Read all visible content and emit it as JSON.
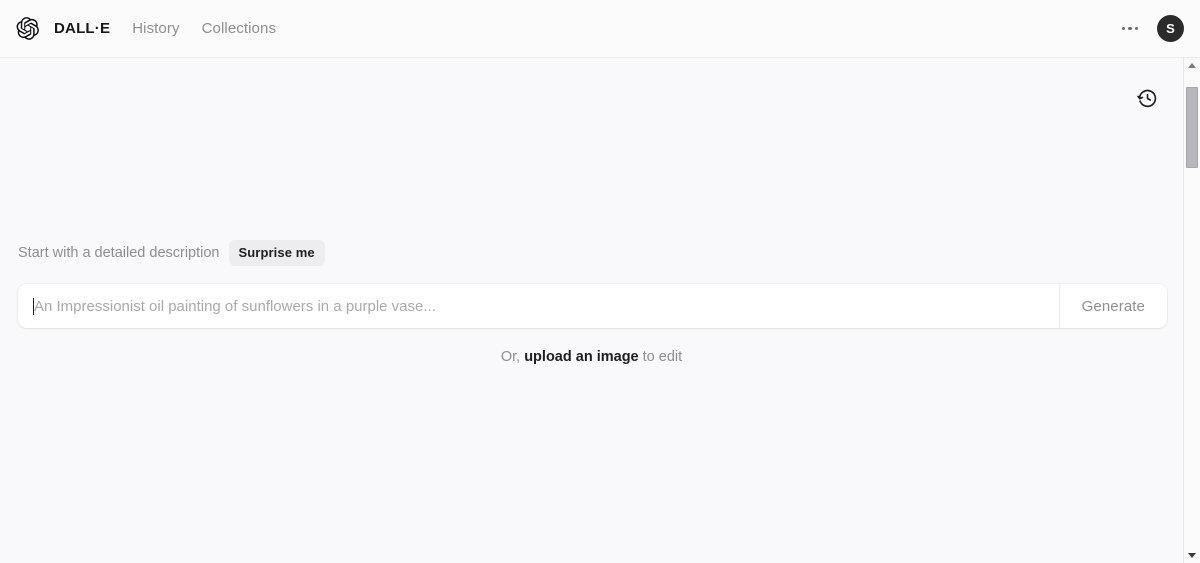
{
  "header": {
    "logo_icon": "openai-logo-icon",
    "nav": [
      {
        "label": "DALL·E",
        "active": true
      },
      {
        "label": "History",
        "active": false
      },
      {
        "label": "Collections",
        "active": false
      }
    ],
    "more_menu_icon": "ellipsis-icon",
    "avatar_initial": "S",
    "avatar_color": "#2b2b2b"
  },
  "main": {
    "history_icon": "clock-rewind-icon",
    "prompt_hint": "Start with a detailed description",
    "surprise_label": "Surprise me",
    "input": {
      "value": "",
      "placeholder": "An Impressionist oil painting of sunflowers in a purple vase..."
    },
    "generate_label": "Generate",
    "upload": {
      "prefix": "Or, ",
      "link": "upload an image",
      "suffix": " to edit"
    }
  },
  "scrollbar": {
    "up_arrow_icon": "chevron-up-icon",
    "down_arrow_icon": "chevron-down-icon",
    "thumb_position_pct": 3,
    "thumb_size_pct": 17
  },
  "colors": {
    "page_background": "#f9f9fb",
    "header_background": "#fbfbfc",
    "text_primary": "#1f1f22",
    "text_muted": "#8e8e93",
    "pill_background": "#ededf0"
  }
}
